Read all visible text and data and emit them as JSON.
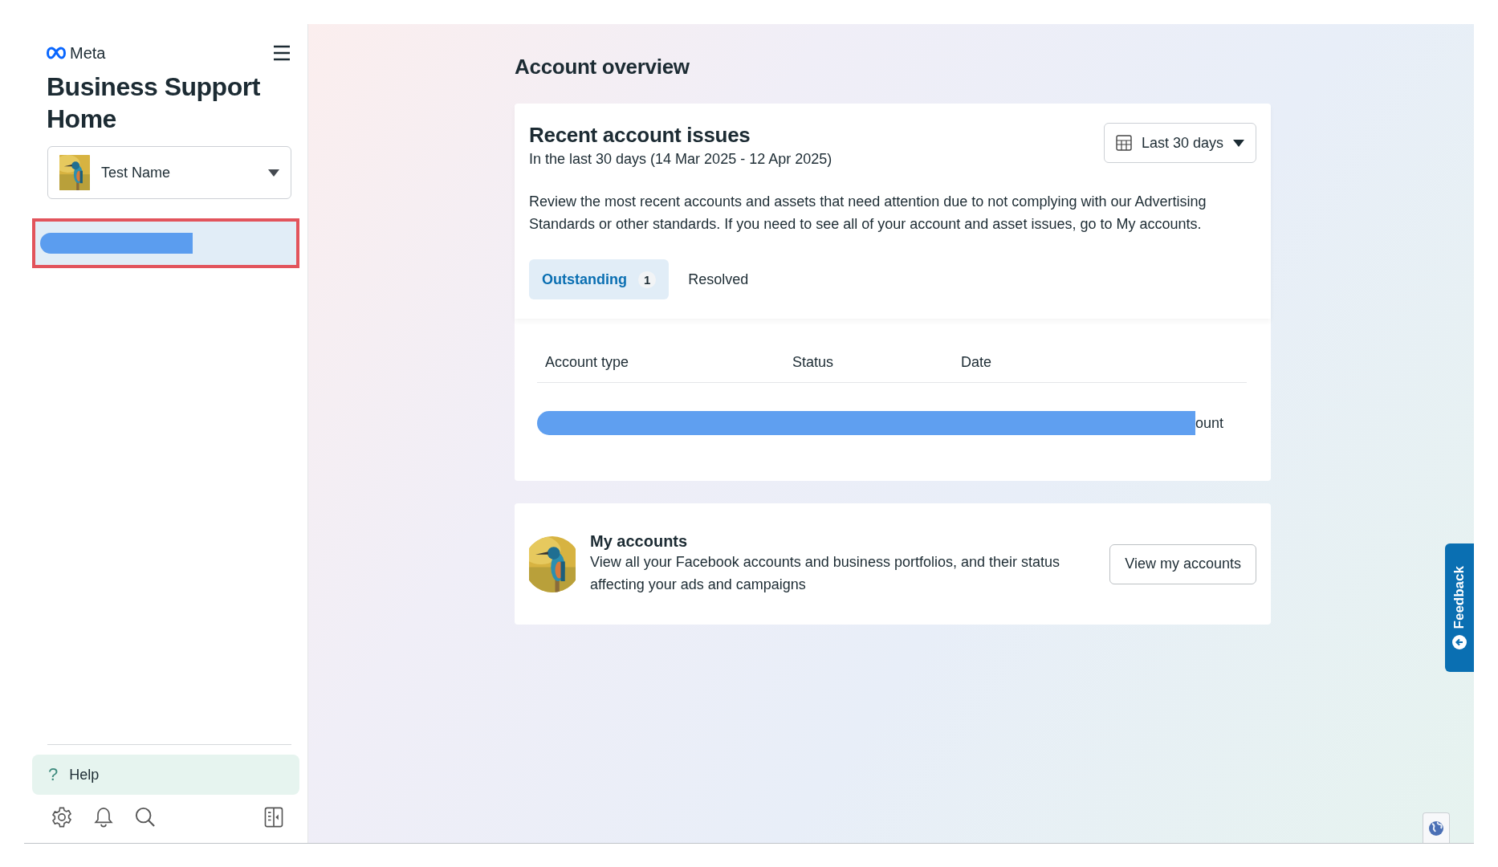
{
  "sidebar": {
    "logo": "Meta",
    "title": "Business Support Home",
    "account_picker": {
      "value": "Test Name"
    },
    "nav_items": [
      {
        "selected": true,
        "outlined": true,
        "redacted": true
      }
    ],
    "help": {
      "icon": "?",
      "label": "Help"
    }
  },
  "main": {
    "heading": "Account overview",
    "issues_card": {
      "title": "Recent account issues",
      "subtitle": "In the last 30 days (14 Mar 2025 - 12 Apr 2025)",
      "date_range": "Last 30 days",
      "description": "Review the most recent accounts and assets that need attention due to not complying with our Advertising Standards or other standards. If you need to see all of your account and asset issues, go to My accounts.",
      "tabs": [
        {
          "label": "Outstanding",
          "count": "1",
          "selected": true
        },
        {
          "label": "Resolved",
          "selected": false
        }
      ],
      "table": {
        "columns": [
          "Account type",
          "Status",
          "Date"
        ],
        "rows": [
          {
            "redacted": true,
            "trailing_text": "ount"
          }
        ]
      }
    },
    "accounts_card": {
      "title": "My accounts",
      "description": "View all your Facebook accounts and business portfolios, and their status affecting your ads and campaigns",
      "button": "View my accounts"
    }
  },
  "feedback_tab": "Feedback"
}
